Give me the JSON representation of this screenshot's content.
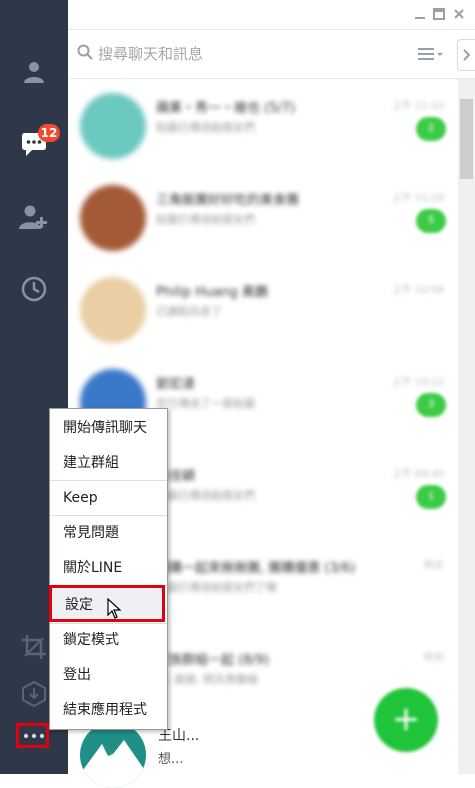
{
  "search": {
    "placeholder": "搜尋聊天和訊息"
  },
  "sidebar": {
    "chat_badge": "12"
  },
  "chats": [
    {
      "name": "蘋果・秀一・維也 (5/7)",
      "msg": "貼圖已傳送給朋友們",
      "time": "上午 11:32",
      "unread": "2",
      "color": "#6cc9c0"
    },
    {
      "name": "三角飯團好好吃的美食團",
      "msg": "貼圖已傳送給朋友們",
      "time": "上午 11:20",
      "unread": "5",
      "color": "#a45a36"
    },
    {
      "name": "Philip Huang 黃鵬",
      "msg": "已讀取訊息了",
      "time": "上午 10:58",
      "unread": "",
      "color": "#e9cfa3"
    },
    {
      "name": "劉宏達",
      "msg": "您已傳送了一張貼圖",
      "time": "上午 10:12",
      "unread": "3",
      "color": "#3a78c9"
    },
    {
      "name": "吳佳穎",
      "msg": "貼圖已傳送給朋友們",
      "time": "上午 09:40",
      "unread": "1",
      "color": "#d8d8d8"
    },
    {
      "name": "團購一起來揪揪團, 團購優惠 (3/6)",
      "msg": "貼圖已傳送給朋友們了喔",
      "time": "昨天",
      "unread": "",
      "color": "#dddddd"
    },
    {
      "name": "家族群組一起 (8/9)",
      "msg": "好, 謝謝, 明天再聯絡",
      "time": "昨天",
      "unread": "",
      "color": "#dddddd"
    }
  ],
  "last_chat": {
    "name": "王山...",
    "msg": "想..."
  },
  "menu": {
    "items": [
      "開始傳訊聊天",
      "建立群組",
      "Keep",
      "常見問題",
      "關於LINE",
      "設定",
      "鎖定模式",
      "登出",
      "結束應用程式"
    ],
    "highlighted": "設定"
  },
  "colors": {
    "sidebar": "#2e3849",
    "accent_green": "#1fc43a",
    "highlight": "#e3000f"
  }
}
